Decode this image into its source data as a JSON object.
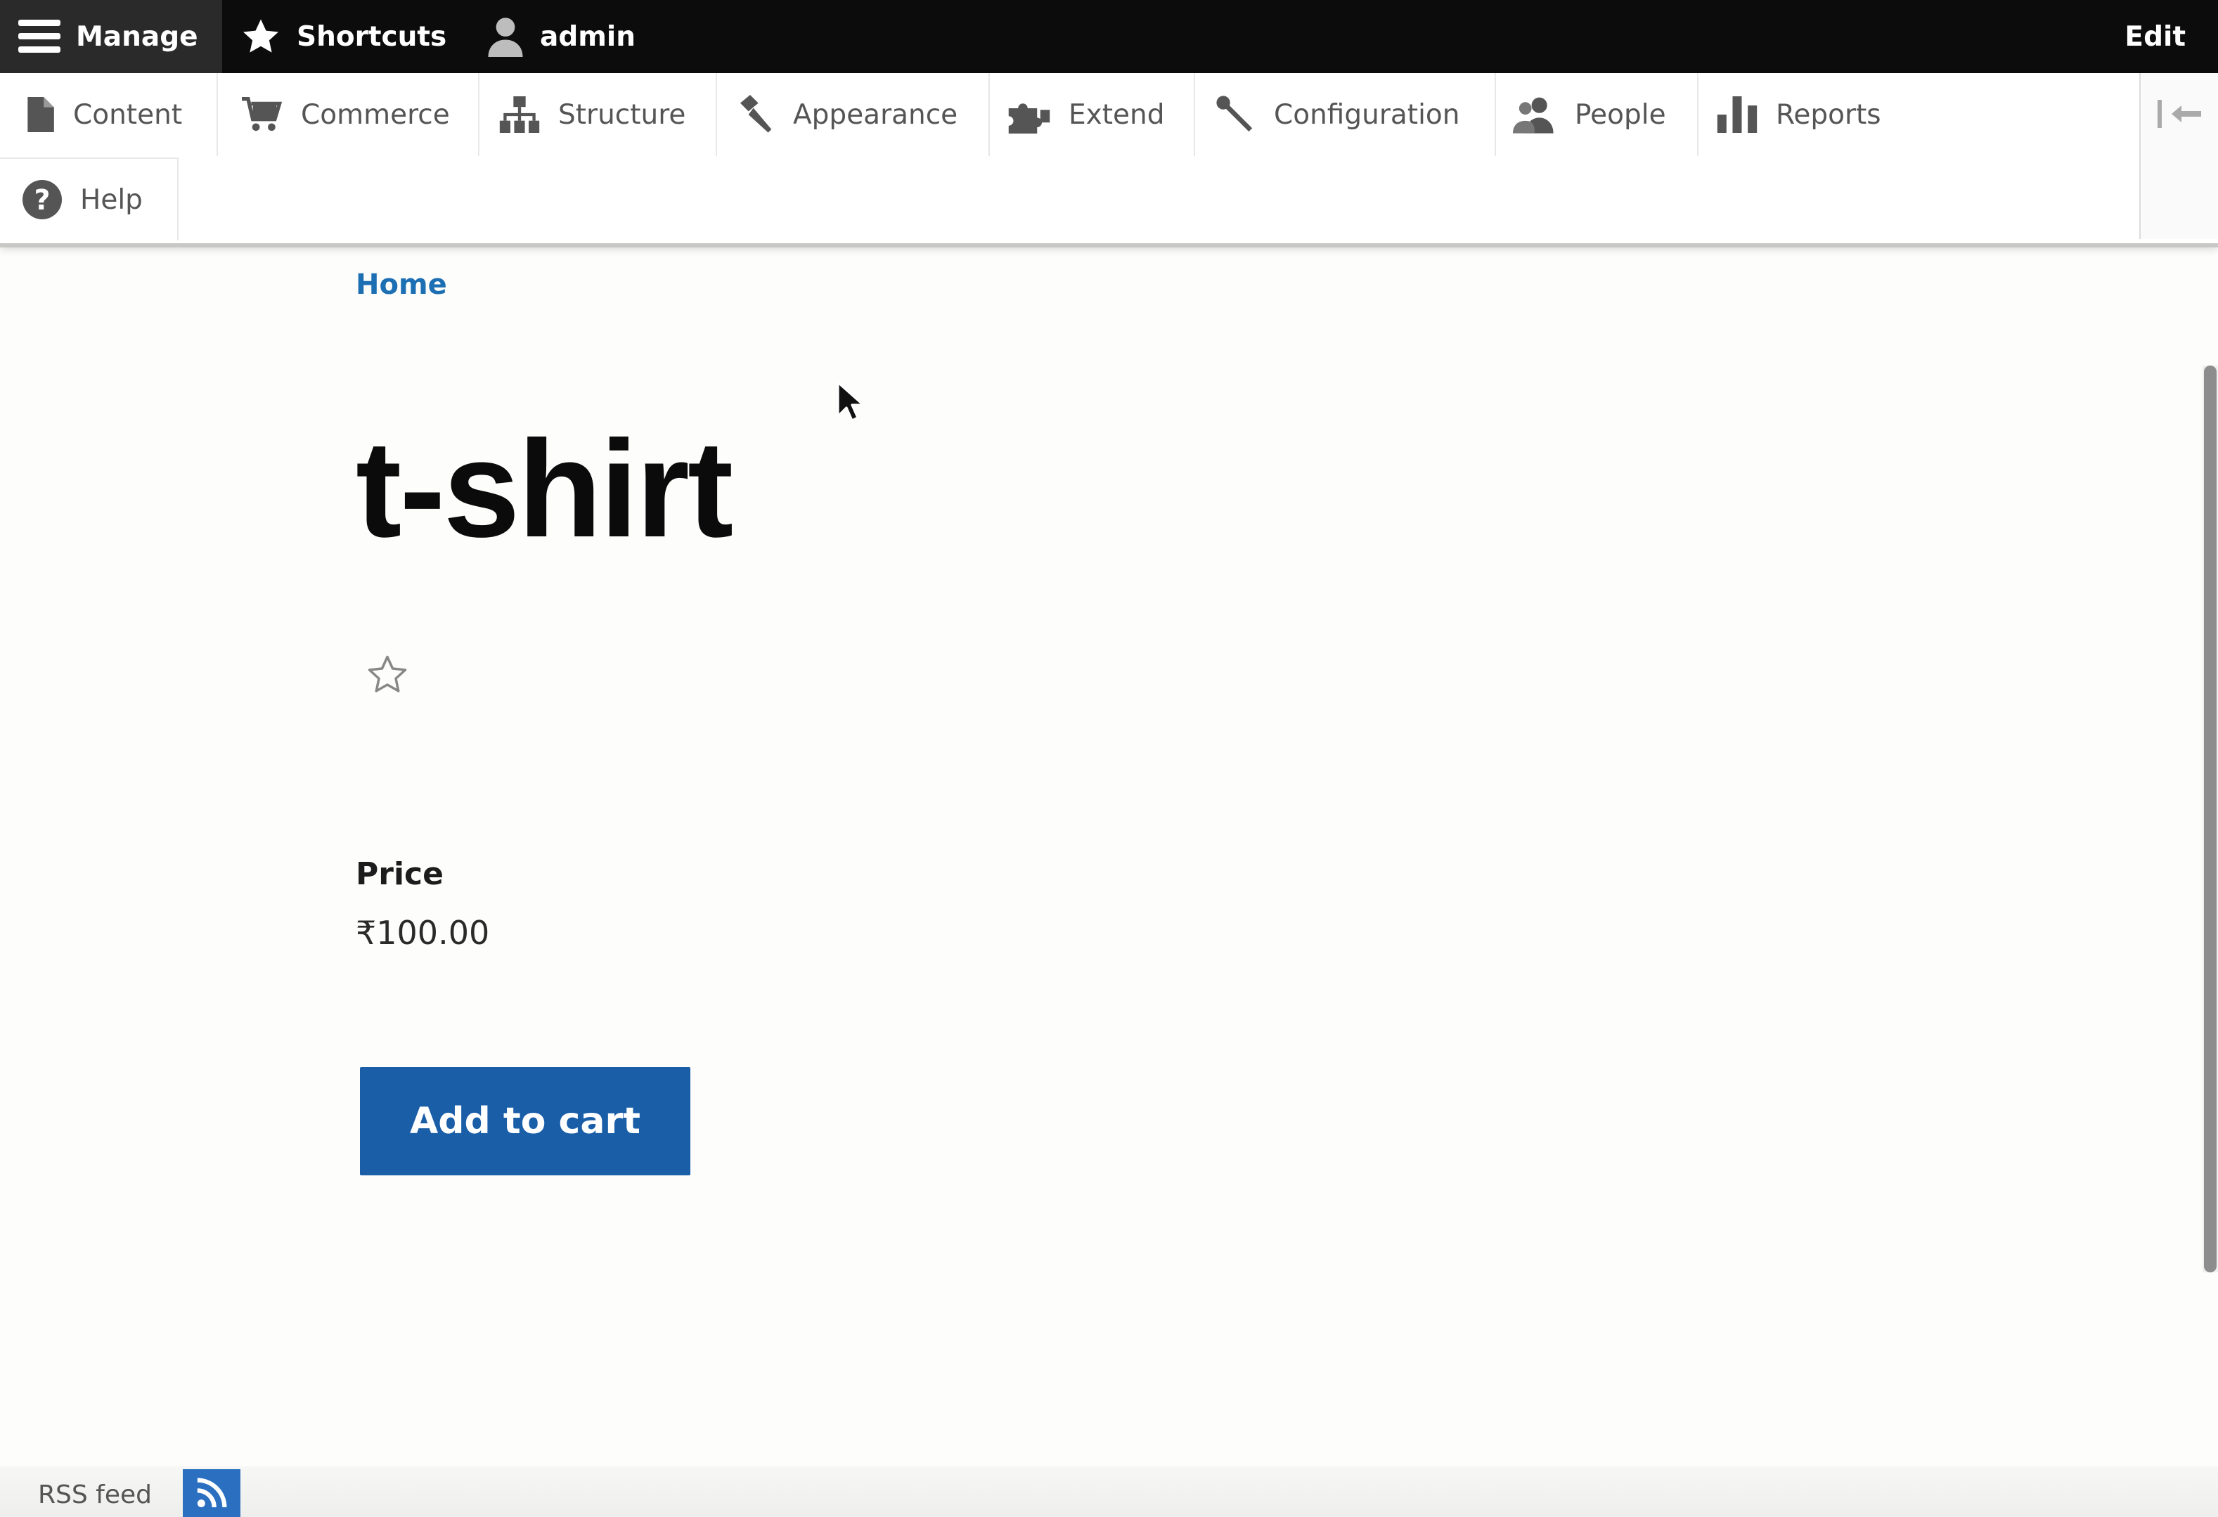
{
  "toolbar": {
    "manage_label": "Manage",
    "shortcuts_label": "Shortcuts",
    "user_label": "admin",
    "edit_label": "Edit"
  },
  "tray": {
    "items": [
      {
        "label": "Content",
        "icon": "file-icon"
      },
      {
        "label": "Commerce",
        "icon": "cart-icon"
      },
      {
        "label": "Structure",
        "icon": "sitemap-icon"
      },
      {
        "label": "Appearance",
        "icon": "paintbrush-icon"
      },
      {
        "label": "Extend",
        "icon": "puzzle-icon"
      },
      {
        "label": "Configuration",
        "icon": "wrench-icon"
      },
      {
        "label": "People",
        "icon": "people-icon"
      },
      {
        "label": "Reports",
        "icon": "bar-chart-icon"
      },
      {
        "label": "Help",
        "icon": "help-icon"
      }
    ]
  },
  "breadcrumb": {
    "home": "Home"
  },
  "product": {
    "title": "t-shirt",
    "price_label": "Price",
    "price_value": "₹100.00",
    "add_to_cart_label": "Add to cart"
  },
  "footer": {
    "rss_label": "RSS feed"
  },
  "colors": {
    "toolbar_bg": "#0c0c0c",
    "link": "#1d6fb3",
    "button_bg": "#1a5ea8"
  }
}
